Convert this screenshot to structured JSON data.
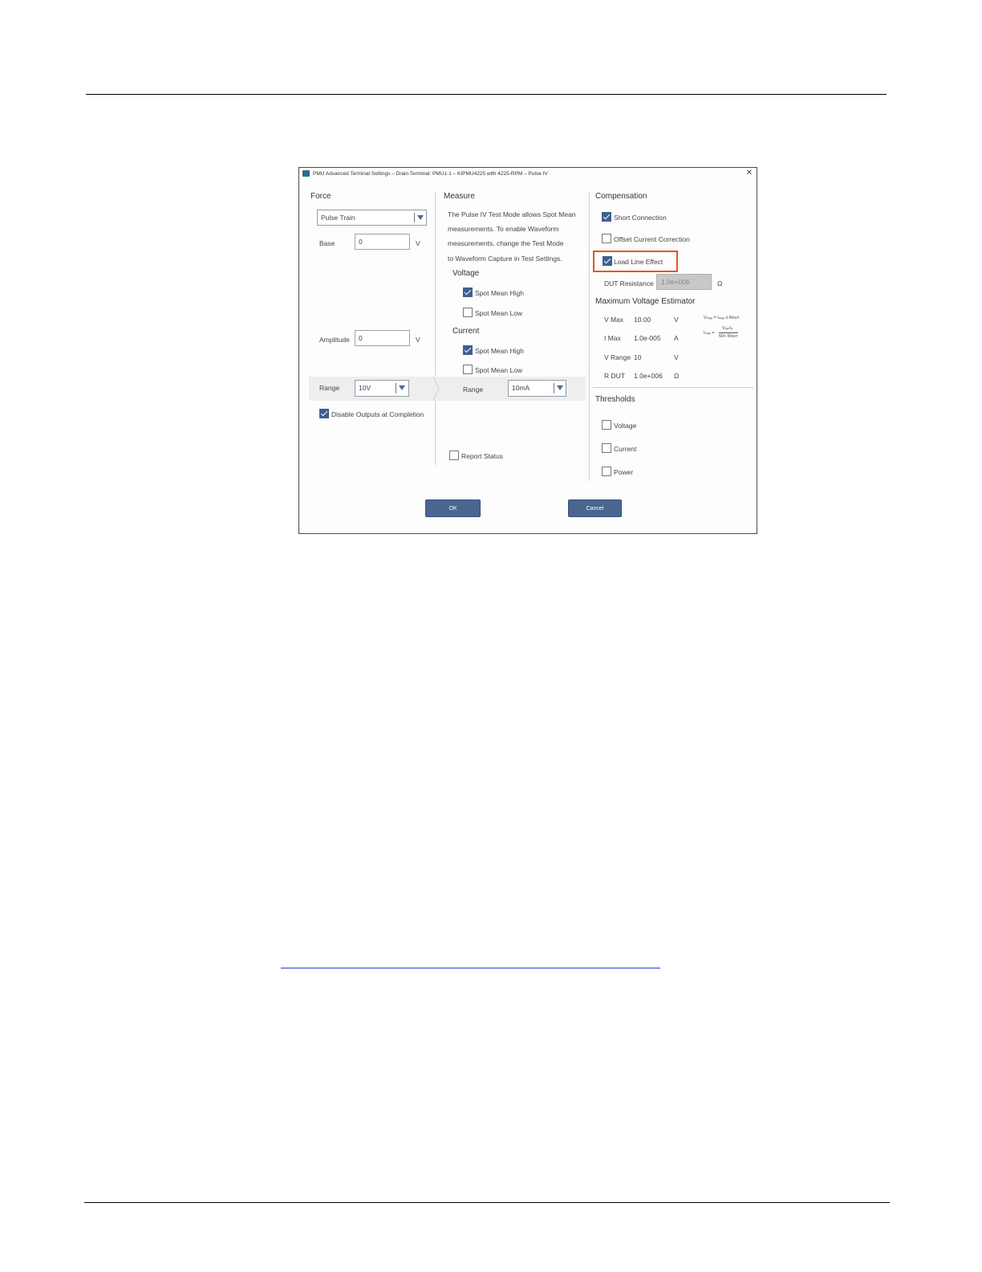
{
  "dialog": {
    "title": "PMU Advanced Terminal Settings – Drain Terminal: PMU1-1 – KIPMU4225 with 4225-RPM – Pulse IV",
    "close_glyph": "✕"
  },
  "force": {
    "heading": "Force",
    "mode_select": "Pulse Train",
    "base_label": "Base",
    "base_value": "0",
    "base_unit": "V",
    "amplitude_label": "Amplitude",
    "amplitude_value": "0",
    "amplitude_unit": "V",
    "range_label": "Range",
    "range_value": "10V",
    "disable_outputs_label": "Disable Outputs at Completion",
    "disable_outputs_checked": true
  },
  "measure": {
    "heading": "Measure",
    "info_line1": "The Pulse IV Test Mode allows Spot Mean",
    "info_line2": "measurements. To enable Waveform",
    "info_line3": "measurements, change the Test Mode",
    "info_line4": "to Waveform Capture in Test Settings.",
    "voltage_heading": "Voltage",
    "v_spot_mean_high": "Spot Mean High",
    "v_spot_mean_high_checked": true,
    "v_spot_mean_low": "Spot Mean Low",
    "v_spot_mean_low_checked": false,
    "current_heading": "Current",
    "i_spot_mean_high": "Spot Mean High",
    "i_spot_mean_high_checked": true,
    "i_spot_mean_low": "Spot Mean Low",
    "i_spot_mean_low_checked": false,
    "range_label": "Range",
    "range_value": "10mA",
    "report_status_label": "Report Status",
    "report_status_checked": false
  },
  "compensation": {
    "heading": "Compensation",
    "short_connection": "Short Connection",
    "short_connection_checked": true,
    "offset_current": "Offset Current Correction",
    "offset_current_checked": false,
    "load_line": "Load Line Effect",
    "load_line_checked": true,
    "dut_resistance_label": "DUT Resistance",
    "dut_resistance_value": "1.0e+006",
    "dut_resistance_unit": "Ω"
  },
  "estimator": {
    "heading": "Maximum Voltage Estimator",
    "rows": [
      {
        "label": "V Max",
        "value": "10.00",
        "unit": "V"
      },
      {
        "label": "I Max",
        "value": "1.0e-005",
        "unit": "A"
      },
      {
        "label": "V Range",
        "value": "10",
        "unit": "V"
      },
      {
        "label": "R DUT",
        "value": "1.0e+006",
        "unit": "Ω"
      }
    ],
    "formula1": "Vₘₐₓ = Iₘₐₓ x Rᴅᴜᴛ",
    "formula2_lhs": "Iₘₐₓ =",
    "formula2_num": "Vᵣₐₙᵍₑ",
    "formula2_den": "50+ Rᴅᴜᴛ"
  },
  "thresholds": {
    "heading": "Thresholds",
    "voltage": "Voltage",
    "current": "Current",
    "power": "Power"
  },
  "buttons": {
    "ok": "OK",
    "cancel": "Cancel"
  },
  "colors": {
    "accent": "#3f5f8f",
    "button": "#4a6690",
    "highlight": "#e2561b"
  }
}
